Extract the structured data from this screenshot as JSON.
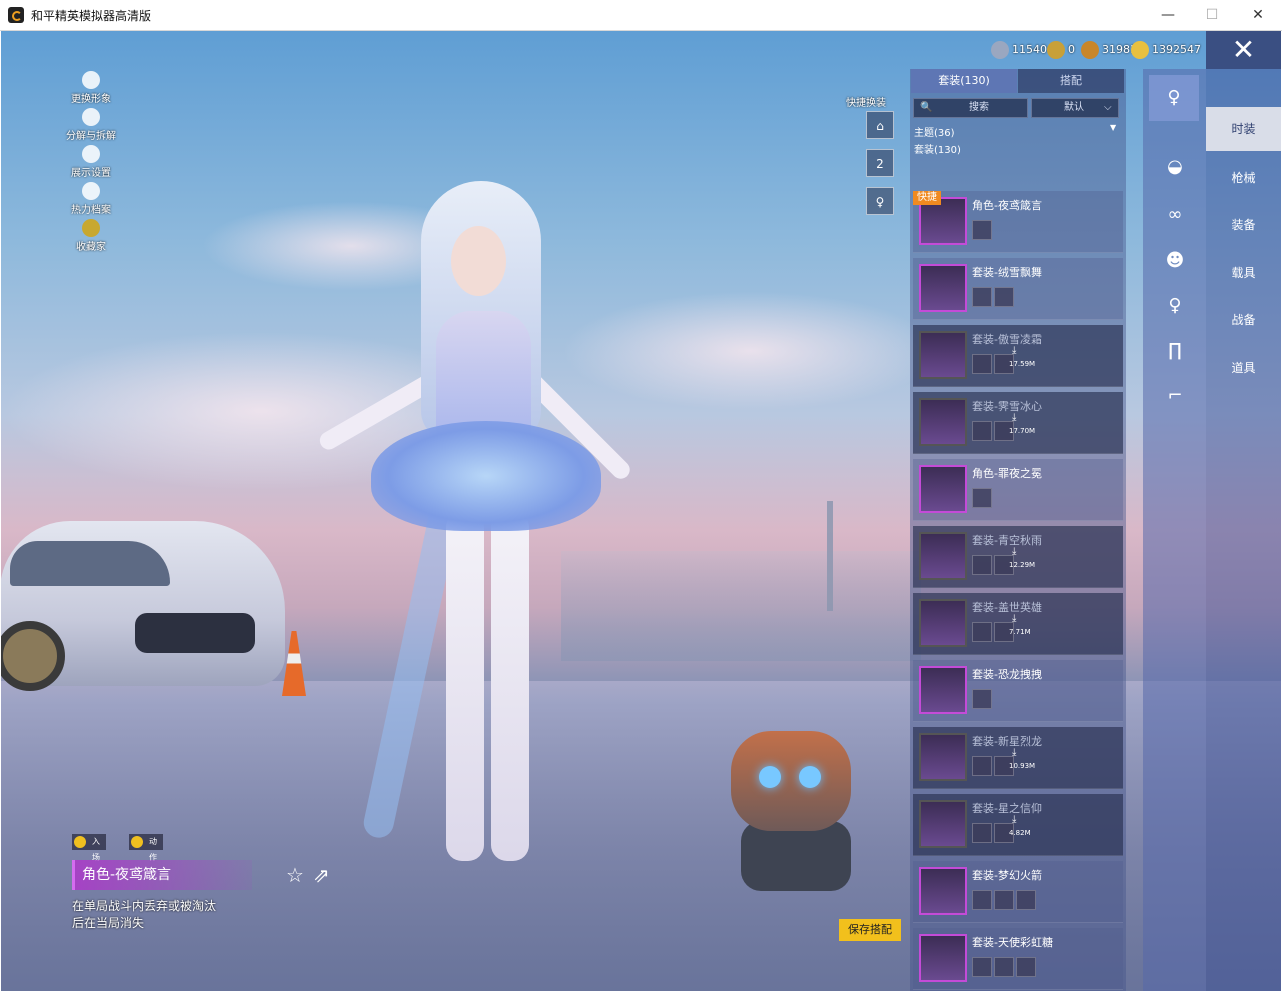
{
  "window": {
    "title": "和平精英模拟器高清版",
    "minimize": "—",
    "maximize": "☐",
    "close": "✕"
  },
  "left_menu": [
    {
      "label": "更换形象",
      "icon": "avatar-icon"
    },
    {
      "label": "分解与拆解",
      "icon": "puzzle-icon"
    },
    {
      "label": "展示设置",
      "icon": "eye-icon"
    },
    {
      "label": "热力档案",
      "icon": "flame-icon"
    },
    {
      "label": "收藏家",
      "icon": "collector-badge-icon"
    }
  ],
  "currencies": [
    {
      "value": "11540",
      "color": "#9aa7c0"
    },
    {
      "value": "0",
      "color": "#c8a038"
    },
    {
      "value": "31981",
      "color": "#c8862a"
    },
    {
      "value": "1392547",
      "color": "#e8c040"
    }
  ],
  "exit_label": "✕",
  "quick_change": {
    "label": "快捷换装",
    "slot2_label": "2"
  },
  "panel": {
    "tabs": [
      "套装(130)",
      "搭配"
    ],
    "search_icon": "🔍",
    "search_placeholder": "搜索",
    "sort_label": "默认",
    "sort_arrow": "⌵",
    "theme_label": "主题(36)",
    "theme_arrow": "▼",
    "set_label": "套装(130)",
    "quick_tag": "快捷",
    "items": [
      {
        "name": "角色-夜鸢箴言",
        "dim": false,
        "size": "",
        "download": ""
      },
      {
        "name": "套装-绒雪飘舞",
        "dim": false,
        "size": "",
        "download": ""
      },
      {
        "name": "套装-傲雪凌霜",
        "dim": true,
        "size": "17.59M",
        "download": "⤓"
      },
      {
        "name": "套装-霁雪冰心",
        "dim": true,
        "size": "17.70M",
        "download": "⤓"
      },
      {
        "name": "角色-罪夜之冕",
        "dim": false,
        "size": "",
        "download": ""
      },
      {
        "name": "套装-青空秋雨",
        "dim": true,
        "size": "12.29M",
        "download": "⤓"
      },
      {
        "name": "套装-盖世英雄",
        "dim": true,
        "size": "7.71M",
        "download": "⤓"
      },
      {
        "name": "套装-恐龙拽拽",
        "dim": false,
        "size": "",
        "download": ""
      },
      {
        "name": "套装-新星烈龙",
        "dim": true,
        "size": "10.93M",
        "download": "⤓"
      },
      {
        "name": "套装-星之信仰",
        "dim": true,
        "size": "4.82M",
        "download": "⤓"
      },
      {
        "name": "套装-梦幻火箭",
        "dim": false,
        "size": "",
        "download": ""
      },
      {
        "name": "套装-天使彩虹糖",
        "dim": false,
        "size": "",
        "download": ""
      }
    ]
  },
  "category_icons": [
    {
      "icon": "character-icon",
      "glyph": "♀"
    },
    {
      "icon": "cap-icon",
      "glyph": "◒"
    },
    {
      "icon": "goggles-icon",
      "glyph": "∞"
    },
    {
      "icon": "mask-icon",
      "glyph": "☻"
    },
    {
      "icon": "outfit-icon",
      "glyph": "♀"
    },
    {
      "icon": "pants-icon",
      "glyph": "∏"
    },
    {
      "icon": "shoes-icon",
      "glyph": "⌐"
    }
  ],
  "categories": [
    "时装",
    "枪械",
    "装备",
    "载具",
    "战备",
    "道具"
  ],
  "action_tags": [
    "入场",
    "动作"
  ],
  "selected": {
    "name": "角色-夜鸢箴言",
    "description": "在单局战斗内丢弃或被淘汰后在当局消失",
    "fav_glyph": "☆",
    "share_glyph": "⇗"
  },
  "save_button": "保存搭配"
}
